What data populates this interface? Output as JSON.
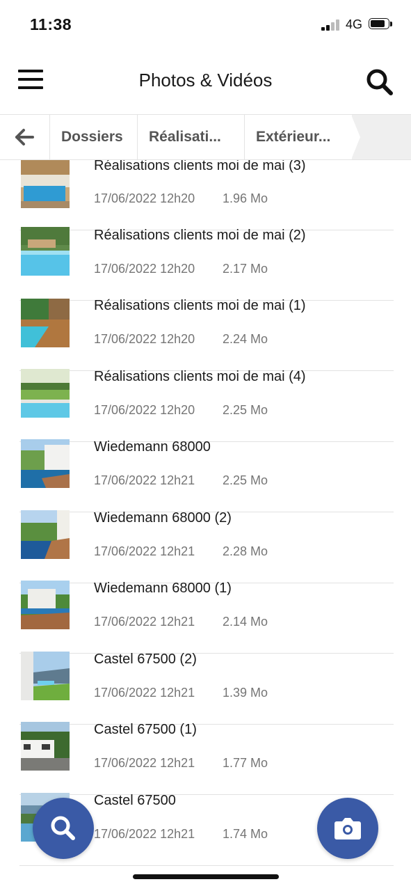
{
  "status_bar": {
    "time": "11:38",
    "network": "4G"
  },
  "header": {
    "title": "Photos & Vidéos"
  },
  "breadcrumb": {
    "items": [
      "Dossiers",
      "Réalisati...",
      "Extérieur..."
    ]
  },
  "files": [
    {
      "title": "Réalisations clients moi de mai (3)",
      "date": "17/06/2022 12h20",
      "size": "1.96 Mo"
    },
    {
      "title": "Réalisations clients moi de mai (2)",
      "date": "17/06/2022 12h20",
      "size": "2.17 Mo"
    },
    {
      "title": "Réalisations clients moi de mai (1)",
      "date": "17/06/2022 12h20",
      "size": "2.24 Mo"
    },
    {
      "title": "Réalisations clients moi de mai (4)",
      "date": "17/06/2022 12h20",
      "size": "2.25 Mo"
    },
    {
      "title": "Wiedemann 68000",
      "date": "17/06/2022 12h21",
      "size": "2.25 Mo"
    },
    {
      "title": "Wiedemann 68000 (2)",
      "date": "17/06/2022 12h21",
      "size": "2.28 Mo"
    },
    {
      "title": "Wiedemann 68000 (1)",
      "date": "17/06/2022 12h21",
      "size": "2.14 Mo"
    },
    {
      "title": "Castel 67500 (2)",
      "date": "17/06/2022 12h21",
      "size": "1.39 Mo"
    },
    {
      "title": "Castel 67500 (1)",
      "date": "17/06/2022 12h21",
      "size": "1.77 Mo"
    },
    {
      "title": "Castel 67500",
      "date": "17/06/2022 12h21",
      "size": "1.74 Mo"
    }
  ],
  "icons": {
    "menu": "hamburger-menu-icon",
    "search": "search-icon",
    "back": "back-arrow-icon",
    "fab_search": "search-icon",
    "fab_camera": "camera-icon"
  },
  "colors": {
    "accent": "#3a5aa6",
    "secondary_text": "#757575",
    "divider": "#e2e2e2"
  }
}
